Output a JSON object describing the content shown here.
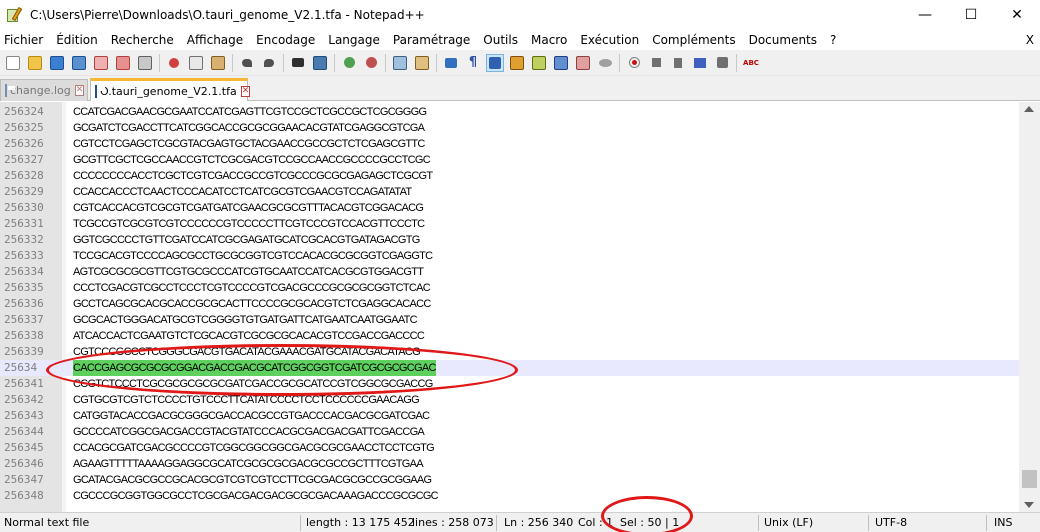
{
  "window": {
    "title": "C:\\Users\\Pierre\\Downloads\\O.tauri_genome_V2.1.tfa - Notepad++",
    "minimize": "—",
    "maximize": "☐",
    "close": "✕"
  },
  "menu": {
    "items": [
      "Fichier",
      "Édition",
      "Recherche",
      "Affichage",
      "Encodage",
      "Langage",
      "Paramétrage",
      "Outils",
      "Macro",
      "Exécution",
      "Compléments",
      "Documents",
      "?"
    ],
    "close_doc": "X"
  },
  "toolbar": {
    "spellcheck_label": "ABC"
  },
  "tabs": [
    {
      "label": "change.log",
      "active": false
    },
    {
      "label": "O.tauri_genome_V2.1.tfa",
      "active": true
    }
  ],
  "editor": {
    "current_line_index": 16,
    "lines": [
      {
        "num": "256324",
        "text": "CCATCGACGAACGCGAATCCATCGAGTTCGTCCGCTCGCCGCTCGCGGGG"
      },
      {
        "num": "256325",
        "text": "GCGATCTCGACCTTCATCGGCACCGCGCGGAACACGTATCGAGGCGTCGA"
      },
      {
        "num": "256326",
        "text": "CGTCCTCGAGCTCGCGTACGAGTGCTACGAACCGCCGCTCTCGAGCGTTC"
      },
      {
        "num": "256327",
        "text": "GCGTTCGCTCGCCAACCGTCTCGCGACGTCCGCCAACCGCCCCGCCTCGC"
      },
      {
        "num": "256328",
        "text": "CCCCCCCCACCTCGCTCGTCGACCGCCGTCGCCCGCGCGAGAGCTCGCGT"
      },
      {
        "num": "256329",
        "text": "CCACCACCCTCAACTCCCACATCCTCATCGCGTCGAACGTCCAGATATAT"
      },
      {
        "num": "256330",
        "text": "CGTCACCACGTCGCGTCGATGATCGAACGCGCGTTTACACGTCGGACACG"
      },
      {
        "num": "256331",
        "text": "TCGCCGTCGCGTCGTCCCCCCGTCCCCCTTCGTCCCGTCCACGTTCCCTC"
      },
      {
        "num": "256332",
        "text": "GGTCGCCCCTGTTCGATCCATCGCGAGATGCATCGCACGTGATAGACGTG"
      },
      {
        "num": "256333",
        "text": "TCCGCACGTCCCCAGCGCCTGCGCGGTCGTCCACACGCGCGGTCGAGGTC"
      },
      {
        "num": "256334",
        "text": "AGTCGCGCGCGTTCGTGCGCCCATCGTGCAATCCATCACGCGTGGACGTT"
      },
      {
        "num": "256335",
        "text": "CCCTCGACGTCGCCTCCCTCGTCCCCGTCGACGCCCGCGCGCGGTCTCAC"
      },
      {
        "num": "256336",
        "text": "GCCTCAGCGCACGCACCGCGCACTTCCCCGCGCACGTCTCGAGGCACACC"
      },
      {
        "num": "256337",
        "text": "GCGCACTGGGACATGCGTCGGGGTGTGATGATTCATGAATCAATGGAATC"
      },
      {
        "num": "256338",
        "text": "ATCACCACTCGAATGTCTCGCACGTCGCGCGCACACGTCCGACCGACCCC"
      },
      {
        "num": "256339",
        "text": "CGTCCCGCCCTCGGGCGACGTGACATACGAAACGATGCATACGACATACG"
      },
      {
        "num": "25634",
        "text": "CACCGAGCGCGCGCGGACGACCGACGCATCGGCGGTCGATCGCGCGCGAC"
      },
      {
        "num": "256341",
        "text": "CCGTCTCCCTCGCGCGCGCGCGATCGACCGCGCATCCGTCGGCGCGACCG"
      },
      {
        "num": "256342",
        "text": "CGTGCGTCGTCTCCCCTGTCCCTTCATATCCCCTCCTCCCCCCGAACAGG"
      },
      {
        "num": "256343",
        "text": "CATGGTACACCGACGCGGGCGACCACGCCGTGACCCACGACGCGATCGAC"
      },
      {
        "num": "256344",
        "text": "GCCCCATCGGCGACGACCGTACGTATCCCACGCGACGACGATTCGACCGA"
      },
      {
        "num": "256345",
        "text": "CCACGCGATCGACGCCCCGTCGGCGGCGGCGACGCGCGAACCTCCTCGTG"
      },
      {
        "num": "256346",
        "text": "AGAAGTTTTTAAAAGGAGGCGCATCGCGCGCGACGCGCCGCTTTCGTGAA"
      },
      {
        "num": "256347",
        "text": "GCATACGACGCGCCGCACGCGTCGTCGTCCTTCGCGACGCGCCGCGGAAG"
      },
      {
        "num": "256348",
        "text": "CGCCCGCGGTGGCGCCTCGCGACGACGACGCGCGACAAAGACCCGCGCGC"
      }
    ]
  },
  "status": {
    "file_type": "Normal text file",
    "length": "length : 13 175 452",
    "lines": "lines : 258 073",
    "ln": "Ln : 256 340",
    "col": "Col : 1",
    "sel": "Sel : 50 | 1",
    "eol": "Unix (LF)",
    "encoding": "UTF-8",
    "mode": "INS"
  },
  "colors": {
    "annotation": "#e01818",
    "selection": "#5ed05e",
    "current_line": "#e8e8ff",
    "tab_accent": "#f7b634"
  }
}
